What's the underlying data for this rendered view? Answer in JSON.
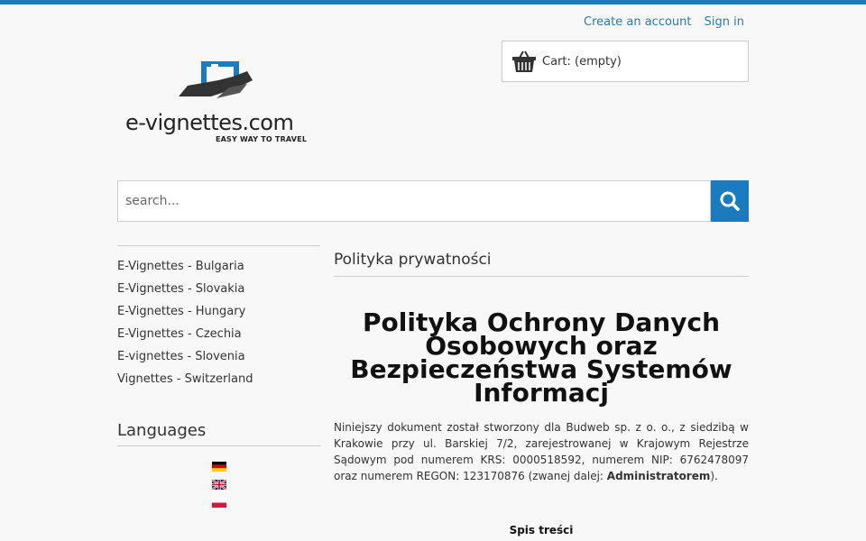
{
  "header": {
    "create_account": "Create an account",
    "sign_in": "Sign in",
    "cart_label": "Cart: (empty)",
    "logo_text": "e-vignettes.com",
    "logo_tagline": "EASY WAY TO TRAVEL"
  },
  "search": {
    "placeholder": "search..."
  },
  "sidebar": {
    "items": [
      "E-Vignettes - Bulgaria",
      "E-Vignettes - Slovakia",
      "E-Vignettes - Hungary",
      "E-Vignettes - Czechia",
      "E-vignettes - Slovenia",
      "Vignettes - Switzerland"
    ],
    "languages_title": "Languages"
  },
  "main": {
    "page_title": "Polityka prywatności",
    "heading": "Polityka Ochrony Danych Osobowych oraz Bezpieczeństwa Systemów Informacj",
    "intro_text": "Niniejszy dokument został stworzony dla Budweb sp. z o. o., z siedzibą w Krakowie przy ul. Barskiej 7/2, zarejestrowanej w Krajowym Rejestrze Sądowym pod numerem KRS: 0000518592, numerem NIP: 6762478097 oraz numerem REGON: 123170876 (zwanej dalej: ",
    "intro_bold": "Administratorem",
    "intro_end": ").",
    "toc_title": "Spis treści"
  },
  "colors": {
    "accent": "#1b7bbf",
    "link": "#2a7ab5"
  }
}
